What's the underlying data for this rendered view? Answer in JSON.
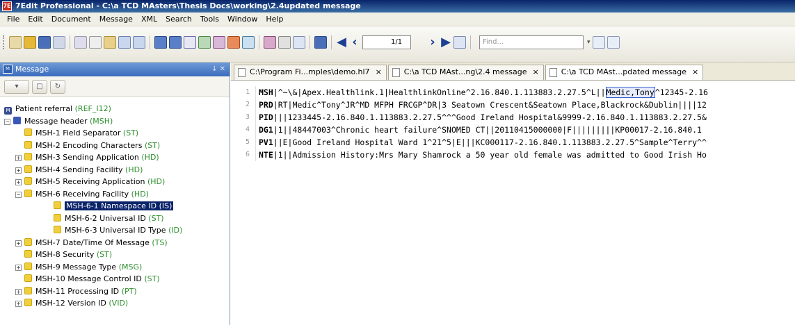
{
  "window": {
    "title": "7Edit Professional - C:\\a TCD MAsters\\Thesis Docs\\working\\2.4updated message",
    "icon_text": "7E"
  },
  "menu": [
    "File",
    "Edit",
    "Document",
    "Message",
    "XML",
    "Search",
    "Tools",
    "Window",
    "Help"
  ],
  "toolbar": {
    "page_current": "1",
    "page_total": "/1",
    "find_placeholder": "Find...",
    "accent_color": "#1c3f94"
  },
  "left_panel": {
    "title": "Message",
    "controls": "↓ ✕"
  },
  "tree": {
    "root": {
      "label": "Patient referral",
      "code": "(REF_I12)"
    },
    "header": {
      "label": "Message header",
      "code": "(MSH)"
    },
    "items": [
      {
        "label": "MSH-1  Field Separator",
        "type": "(ST)"
      },
      {
        "label": "MSH-2  Encoding Characters",
        "type": "(ST)"
      },
      {
        "label": "MSH-3  Sending Application",
        "type": "(HD)"
      },
      {
        "label": "MSH-4  Sending Facility",
        "type": "(HD)"
      },
      {
        "label": "MSH-5  Receiving Application",
        "type": "(HD)"
      },
      {
        "label": "MSH-6  Receiving Facility",
        "type": "(HD)"
      }
    ],
    "sub_items": [
      {
        "label": "MSH-6-1  Namespace ID",
        "type": "(IS)"
      },
      {
        "label": "MSH-6-2  Universal ID",
        "type": "(ST)"
      },
      {
        "label": "MSH-6-3  Universal ID Type",
        "type": "(ID)"
      }
    ],
    "items_after": [
      {
        "label": "MSH-7  Date/Time Of Message",
        "type": "(TS)"
      },
      {
        "label": "MSH-8  Security",
        "type": "(ST)"
      },
      {
        "label": "MSH-9  Message Type",
        "type": "(MSG)"
      },
      {
        "label": "MSH-10  Message Control ID",
        "type": "(ST)"
      },
      {
        "label": "MSH-11  Processing ID",
        "type": "(PT)"
      },
      {
        "label": "MSH-12  Version ID",
        "type": "(VID)"
      }
    ]
  },
  "tabs": [
    {
      "label": "C:\\Program Fi...mples\\demo.hl7",
      "close": "×"
    },
    {
      "label": "C:\\a TCD MAst...ng\\2.4 message",
      "close": "×"
    },
    {
      "label": "C:\\a TCD MAst...pdated message",
      "close": "×"
    }
  ],
  "code": {
    "line1_pre": "|^~\\&|Apex.Healthlink.1|HealthlinkOnline^2.16.840.1.113883.2.27.5^L||",
    "line1_highlight": "Medic,Tony",
    "line1_post": "^12345-2.16",
    "lines": [
      {
        "num": "1",
        "seg": "MSH"
      },
      {
        "num": "2",
        "seg": "PRD",
        "text": "|RT|Medic^Tony^JR^MD MFPH FRCGP^DR|3 Seatown Crescent&Seatown Place,Blackrock&Dublin||||12"
      },
      {
        "num": "3",
        "seg": "PID",
        "text": "|||1233445-2.16.840.1.113883.2.27.5^^^Good Ireland Hospital&9999-2.16.840.1.113883.2.27.5&"
      },
      {
        "num": "4",
        "seg": "DG1",
        "text": "|1||48447003^Chronic heart failure^SNOMED CT||20110415000000|F|||||||||KP00017-2.16.840.1"
      },
      {
        "num": "5",
        "seg": "PV1",
        "text": "||E|Good Ireland Hospital Ward 1^21^5|E|||KC000117-2.16.840.1.113883.2.27.5^Sample^Terry^^"
      },
      {
        "num": "6",
        "seg": "NTE",
        "text": "|1||Admission History:Mrs Mary Shamrock a 50 year old female was admitted to Good Irish Ho"
      }
    ]
  }
}
